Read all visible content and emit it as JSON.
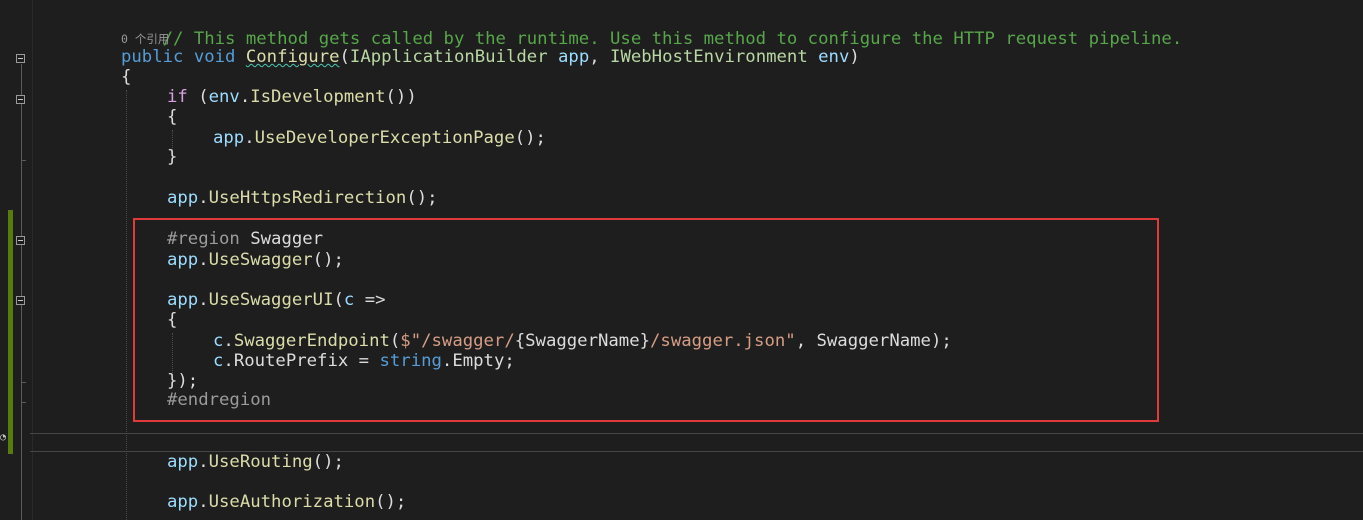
{
  "codelens": "0 个引用",
  "lines": {
    "comment": "// This method gets called by the runtime. Use this method to configure the HTTP request pipeline.",
    "sig_public": "public",
    "sig_void": "void",
    "sig_method": "Configure",
    "sig_open": "(",
    "sig_type1": "IApplicationBuilder",
    "sig_param1": "app",
    "sig_comma": ",",
    "sig_type2": "IWebHostEnvironment",
    "sig_param2": "env",
    "sig_close": ")",
    "brace_open": "{",
    "if_kw": "if",
    "if_open": " (",
    "if_env": "env",
    "if_dot": ".",
    "if_method": "IsDevelopment",
    "if_close": "())",
    "inner_open": "{",
    "dev_app": "app",
    "dev_dot": ".",
    "dev_method": "UseDeveloperExceptionPage",
    "dev_tail": "();",
    "inner_close": "}",
    "https_app": "app",
    "https_dot": ".",
    "https_method": "UseHttpsRedirection",
    "https_tail": "();",
    "region_kw": "#region",
    "region_name": " Swagger",
    "sw_app": "app",
    "sw_dot": ".",
    "sw_method": "UseSwagger",
    "sw_tail": "();",
    "ui_app": "app",
    "ui_dot": ".",
    "ui_method": "UseSwaggerUI",
    "ui_open": "(",
    "ui_c": "c",
    "ui_arrow": " =>",
    "lambda_open": "{",
    "ep_c": "c",
    "ep_dot": ".",
    "ep_method": "SwaggerEndpoint",
    "ep_open": "(",
    "ep_str1": "$\"/swagger/",
    "ep_interp": "{SwaggerName}",
    "ep_str2": "/swagger.json\"",
    "ep_comma": ", ",
    "ep_name": "SwaggerName",
    "ep_close": ");",
    "rp_c": "c",
    "rp_dot": ".",
    "rp_prop": "RoutePrefix",
    "rp_eq": " = ",
    "rp_kw": "string",
    "rp_dot2": ".",
    "rp_empty": "Empty;",
    "lambda_close": "});",
    "endregion": "#endregion",
    "routing_app": "app",
    "routing_dot": ".",
    "routing_method": "UseRouting",
    "routing_tail": "();",
    "auth_app": "app",
    "auth_dot": ".",
    "auth_method": "UseAuthorization",
    "auth_tail": "();"
  },
  "colors": {
    "background": "#1e1e1e",
    "comment": "#57a64a",
    "keyword": "#569cd6",
    "control": "#d8a0df",
    "method": "#dcdcaa",
    "type": "#b8d7a3",
    "parameter": "#9cdcfe",
    "string": "#d69d85",
    "preprocessor": "#9b9b9b",
    "highlight_box": "#e03a3a",
    "change_bar": "#587c0c"
  }
}
